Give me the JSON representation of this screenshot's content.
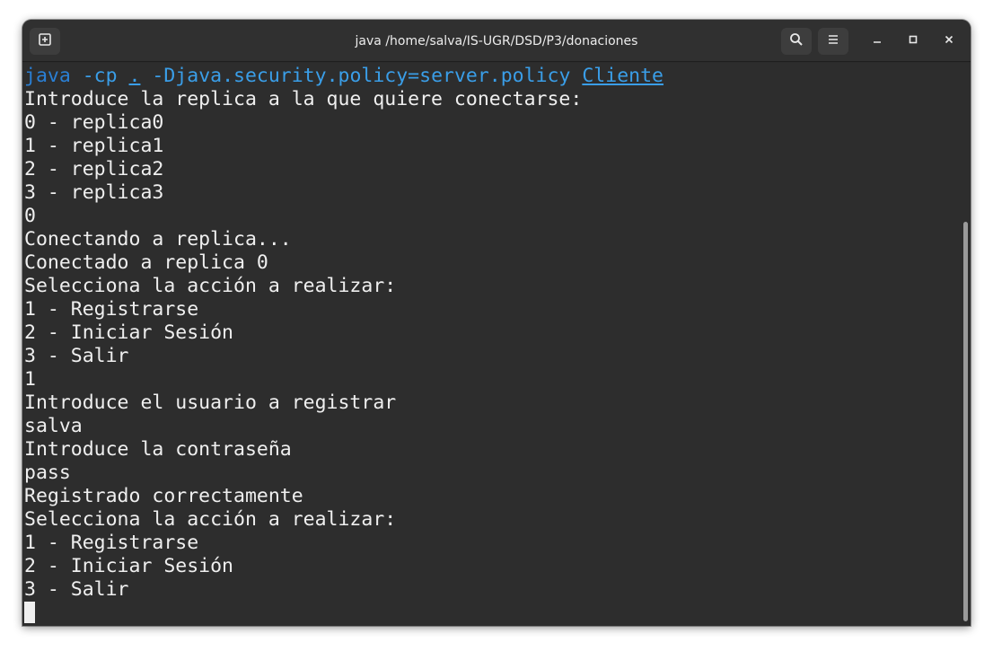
{
  "window": {
    "title": "java /home/salva/IS-UGR/DSD/P3/donaciones"
  },
  "headerbar": {
    "new_tab_icon": "new-tab-icon",
    "search_icon": "search-icon",
    "menu_icon": "hamburger-menu-icon",
    "minimize_icon": "minimize-icon",
    "maximize_icon": "maximize-icon",
    "close_icon": "close-icon"
  },
  "terminal": {
    "command": {
      "program": "java",
      "flag": " -cp ",
      "classpath": ".",
      "policy": " -Djava.security.policy=server.policy ",
      "main_class": "Cliente"
    },
    "lines": [
      "Introduce la replica a la que quiere conectarse:",
      "0 - replica0",
      "1 - replica1",
      "2 - replica2",
      "3 - replica3",
      "0",
      "Conectando a replica...",
      "Conectado a replica 0",
      "Selecciona la acción a realizar:",
      "1 - Registrarse",
      "2 - Iniciar Sesión",
      "3 - Salir",
      "1",
      "Introduce el usuario a registrar",
      "salva",
      "Introduce la contraseña",
      "pass",
      "Registrado correctamente",
      "Selecciona la acción a realizar:",
      "1 - Registrarse",
      "2 - Iniciar Sesión",
      "3 - Salir"
    ]
  },
  "colors": {
    "terminal_bg": "#2d2d2d",
    "text": "#efefef",
    "command_blue": "#3a9ee8",
    "titlebar_bg": "#303030"
  }
}
